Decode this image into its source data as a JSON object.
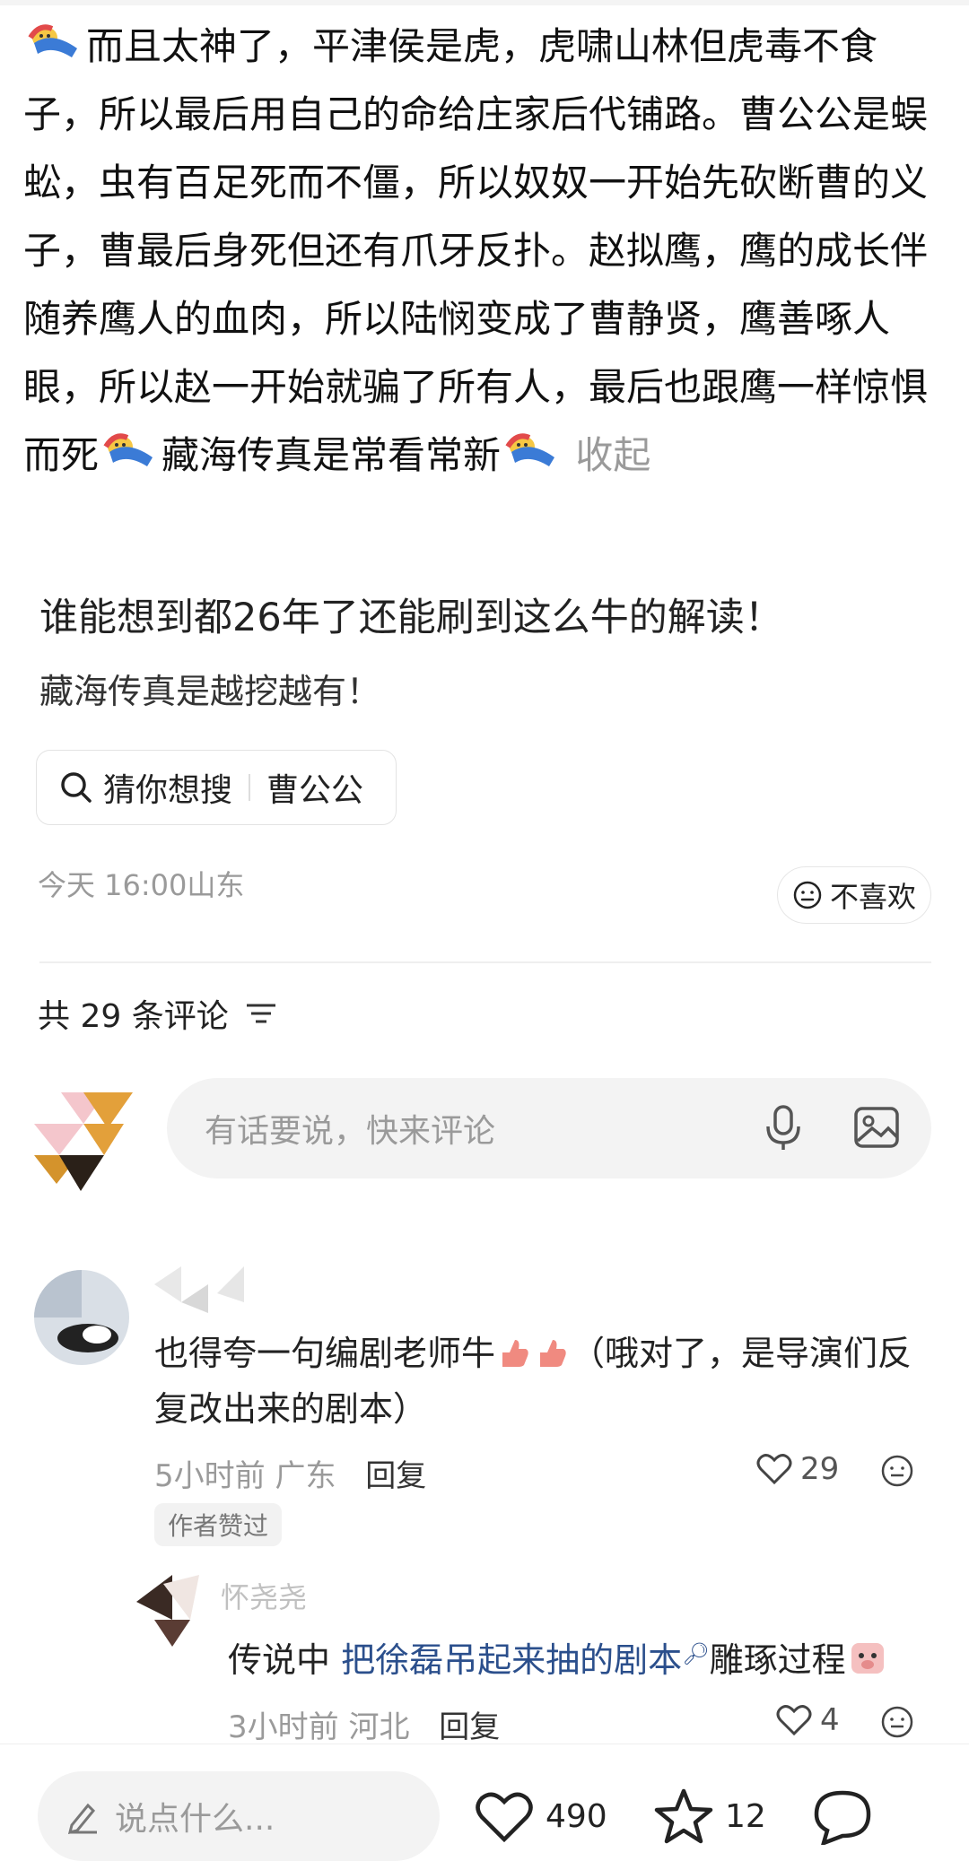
{
  "post": {
    "text_parts": [
      "而且太神了，平津侯是虎，虎啸山林但虎毒不食子，所以最后用自己的命给庄家后代铺路。曹公公是蜈蚣，虫有百足死而不僵，所以奴奴一开始先砍断曹的义子，曹最后身死但还有爪牙反扑。赵拟鹰，鹰的成长伴随养鹰人的血肉，所以陆悯变成了曹静贤，鹰善啄人眼，所以赵一开始就骗了所有人，最后也跟鹰一样惊惧而死",
      "藏海传真是常看常新"
    ],
    "collapse_label": "收起",
    "quote_title": "谁能想到都26年了还能刷到这么牛的解读！",
    "quote_sub": "藏海传真是越挖越有！",
    "search_chip": {
      "prefix": "猜你想搜",
      "term": "曹公公",
      "icon": "search-icon"
    },
    "meta": "今天 16:00山东",
    "dislike_label": "不喜欢"
  },
  "comments_header": {
    "count_label": "共 29 条评论",
    "sort_icon": "sort-icon"
  },
  "input": {
    "placeholder": "有话要说，快来评论",
    "icons": [
      "microphone-icon",
      "image-icon"
    ]
  },
  "comments": [
    {
      "text_before": "也得夸一句编剧老师牛",
      "text_after": "（哦对了，是导演们反复改出来的剧本）",
      "time": "5小时前",
      "location": "广东",
      "reply_label": "回复",
      "likes": "29",
      "badge": "作者赞过"
    }
  ],
  "reply": {
    "name": "怀尧尧",
    "text_before": "传说中 ",
    "link": "把徐磊吊起来抽的剧本",
    "text_after": "雕琢过程",
    "time": "3小时前",
    "location": "河北",
    "reply_label": "回复",
    "likes": "4"
  },
  "bottom_bar": {
    "placeholder": "说点什么...",
    "likes": "490",
    "favorites": "12",
    "comment_icon": "comment-bubble-icon"
  },
  "colors": {
    "link": "#2b4f8c",
    "muted": "#9a9a9a",
    "pill_bg": "#f3f3f3"
  }
}
